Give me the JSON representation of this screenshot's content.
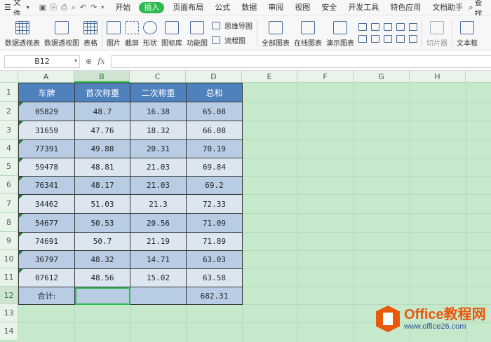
{
  "menubar": {
    "file_label": "文件",
    "tabs": [
      "开始",
      "插入",
      "页面布局",
      "公式",
      "数据",
      "审阅",
      "视图",
      "安全",
      "开发工具",
      "特色应用",
      "文档助手"
    ],
    "active_tab": "插入",
    "search_label": "查找"
  },
  "ribbon": {
    "pivot_table": "数据透视表",
    "pivot_chart": "数据透视图",
    "table": "表格",
    "picture": "图片",
    "screenshot": "截屏",
    "shape": "形状",
    "icon_lib": "图标库",
    "func_chart": "功能图",
    "mindmap": "思维导图",
    "flowchart": "流程图",
    "all_charts": "全部图表",
    "online_charts": "在线图表",
    "demo_charts": "演示图表",
    "slicer": "切片器",
    "textbox": "文本框"
  },
  "formulabar": {
    "cell_ref": "B12",
    "fx": "fx",
    "value": ""
  },
  "columns": [
    "A",
    "B",
    "C",
    "D",
    "E",
    "F",
    "G",
    "H"
  ],
  "rows": [
    "1",
    "2",
    "3",
    "4",
    "5",
    "6",
    "7",
    "8",
    "9",
    "10",
    "11",
    "12",
    "13",
    "14"
  ],
  "table": {
    "headers": [
      "车牌",
      "首次称重",
      "二次称重",
      "总和"
    ],
    "rows": [
      [
        "05829",
        "48.7",
        "16.38",
        "65.08"
      ],
      [
        "31659",
        "47.76",
        "18.32",
        "66.08"
      ],
      [
        "77391",
        "49.88",
        "20.31",
        "70.19"
      ],
      [
        "59478",
        "48.81",
        "21.03",
        "69.84"
      ],
      [
        "76341",
        "48.17",
        "21.03",
        "69.2"
      ],
      [
        "34462",
        "51.03",
        "21.3",
        "72.33"
      ],
      [
        "54677",
        "50.53",
        "20.56",
        "71.09"
      ],
      [
        "74691",
        "50.7",
        "21.19",
        "71.89"
      ],
      [
        "36797",
        "48.32",
        "14.71",
        "63.03"
      ],
      [
        "07612",
        "48.56",
        "15.02",
        "63.58"
      ]
    ],
    "total_label": "合计:",
    "total_value": "682.31"
  },
  "watermark": {
    "brand": "Office教程网",
    "url": "www.office26.com"
  },
  "colors": {
    "accent": "#2dba4e",
    "header_fill": "#4f81bd",
    "band_dark": "#b8cce4",
    "band_light": "#dce6f1",
    "sheet_bg": "#c6e8cb"
  }
}
